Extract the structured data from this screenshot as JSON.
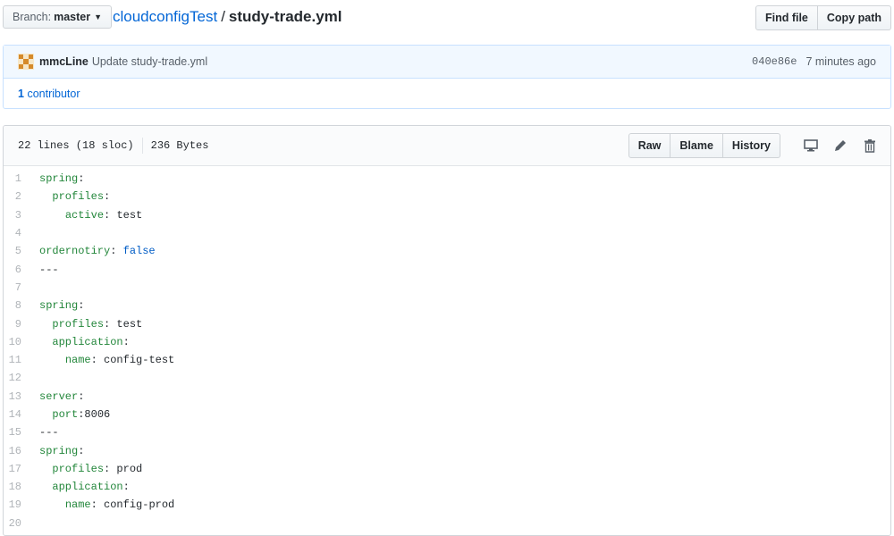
{
  "branch": {
    "label": "Branch:",
    "name": "master"
  },
  "breadcrumb": {
    "repo": "cloudconfigTest",
    "separator": "/",
    "file": "study-trade.yml"
  },
  "top_buttons": {
    "find_file": "Find file",
    "copy_path": "Copy path"
  },
  "commit": {
    "author": "mmcLine",
    "message": "Update study-trade.yml",
    "sha": "040e86e",
    "time": "7 minutes ago"
  },
  "contributors": {
    "count": "1",
    "label": "contributor"
  },
  "file": {
    "lines": "22 lines (18 sloc)",
    "size": "236 Bytes",
    "buttons": {
      "raw": "Raw",
      "blame": "Blame",
      "history": "History"
    },
    "icons": [
      "desktop-icon",
      "pencil-icon",
      "trash-icon"
    ]
  },
  "code_lines": [
    {
      "n": "1",
      "indent": "",
      "key": "spring",
      "sep": ":",
      "val": "",
      "vtype": "v"
    },
    {
      "n": "2",
      "indent": "  ",
      "key": "profiles",
      "sep": ":",
      "val": "",
      "vtype": "v"
    },
    {
      "n": "3",
      "indent": "    ",
      "key": "active",
      "sep": ": ",
      "val": "test",
      "vtype": "v"
    },
    {
      "n": "4",
      "indent": "",
      "key": "",
      "sep": "",
      "val": "",
      "vtype": "v"
    },
    {
      "n": "5",
      "indent": "",
      "key": "ordernotiry",
      "sep": ": ",
      "val": "false",
      "vtype": "c"
    },
    {
      "n": "6",
      "indent": "",
      "key": "---",
      "sep": "",
      "val": "",
      "vtype": "v"
    },
    {
      "n": "7",
      "indent": "",
      "key": "",
      "sep": "",
      "val": "",
      "vtype": "v"
    },
    {
      "n": "8",
      "indent": "",
      "key": "spring",
      "sep": ":",
      "val": "",
      "vtype": "v"
    },
    {
      "n": "9",
      "indent": "  ",
      "key": "profiles",
      "sep": ": ",
      "val": "test",
      "vtype": "v"
    },
    {
      "n": "10",
      "indent": "  ",
      "key": "application",
      "sep": ":",
      "val": "",
      "vtype": "v"
    },
    {
      "n": "11",
      "indent": "    ",
      "key": "name",
      "sep": ": ",
      "val": "config-test",
      "vtype": "v"
    },
    {
      "n": "12",
      "indent": "",
      "key": "",
      "sep": "",
      "val": "",
      "vtype": "v"
    },
    {
      "n": "13",
      "indent": "",
      "key": "server",
      "sep": ":",
      "val": "",
      "vtype": "v"
    },
    {
      "n": "14",
      "indent": "  ",
      "key": "port",
      "sep": ":",
      "val": "8006",
      "vtype": "v"
    },
    {
      "n": "15",
      "indent": "",
      "key": "---",
      "sep": "",
      "val": "",
      "vtype": "v"
    },
    {
      "n": "16",
      "indent": "",
      "key": "spring",
      "sep": ":",
      "val": "",
      "vtype": "v"
    },
    {
      "n": "17",
      "indent": "  ",
      "key": "profiles",
      "sep": ": ",
      "val": "prod",
      "vtype": "v"
    },
    {
      "n": "18",
      "indent": "  ",
      "key": "application",
      "sep": ":",
      "val": "",
      "vtype": "v"
    },
    {
      "n": "19",
      "indent": "    ",
      "key": "name",
      "sep": ": ",
      "val": "config-prod",
      "vtype": "v"
    },
    {
      "n": "20",
      "indent": "",
      "key": "",
      "sep": "",
      "val": "",
      "vtype": "v"
    }
  ]
}
